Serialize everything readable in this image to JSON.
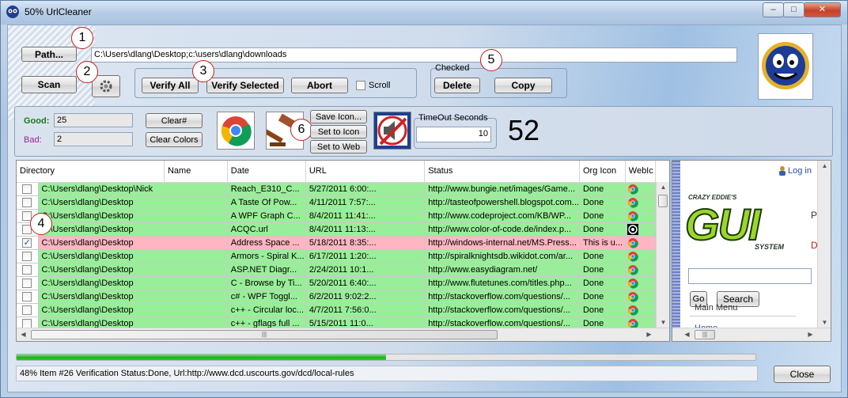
{
  "window": {
    "title": "50% UrlCleaner",
    "min": "–",
    "max": "□",
    "close": "✕"
  },
  "toolbar": {
    "path_label": "Path...",
    "path_value": "C:\\Users\\dlang\\Desktop;c:\\users\\dlang\\downloads",
    "scan_label": "Scan",
    "verify_all_label": "Verify All",
    "verify_selected_label": "Verify Selected",
    "abort_label": "Abort",
    "scroll_label": "Scroll",
    "checked_group_label": "Checked",
    "delete_label": "Delete",
    "copy_label": "Copy"
  },
  "callouts": [
    "1",
    "2",
    "3",
    "4",
    "5",
    "6"
  ],
  "stats": {
    "good_label": "Good:",
    "good_value": "25",
    "bad_label": "Bad:",
    "bad_value": "2",
    "clear_num_label": "Clear#",
    "clear_colors_label": "Clear Colors",
    "save_icon_label": "Save Icon...",
    "set_to_icon_label": "Set to Icon",
    "set_to_web_label": "Set to Web",
    "timeout_label": "TimeOut Seconds",
    "timeout_value": "10",
    "big_count": "52"
  },
  "grid": {
    "columns": [
      "Directory",
      "Name",
      "Date",
      "URL",
      "Status",
      "Org Icon",
      "WebIc"
    ],
    "rows": [
      {
        "checked": false,
        "status_class": "good",
        "directory": "C:\\Users\\dlang\\Desktop\\Nick",
        "name": "Reach_E310_C...",
        "date": "5/27/2011 6:00:...",
        "url": "http://www.bungie.net/images/Game...",
        "status": "Done",
        "org_icon": "chrome",
        "web_icon": ""
      },
      {
        "checked": false,
        "status_class": "good",
        "directory": "C:\\Users\\dlang\\Desktop",
        "name": "A Taste Of Pow...",
        "date": "4/11/2011 7:57:...",
        "url": "http://tasteofpowershell.blogspot.com...",
        "status": "Done",
        "org_icon": "chrome",
        "web_icon": "blogger"
      },
      {
        "checked": false,
        "status_class": "good",
        "directory": "C:\\Users\\dlang\\Desktop",
        "name": "A WPF Graph C...",
        "date": "8/4/2011 11:41:...",
        "url": "http://www.codeproject.com/KB/WP...",
        "status": "Done",
        "org_icon": "chrome",
        "web_icon": "blogger"
      },
      {
        "checked": false,
        "status_class": "good",
        "directory": "C:\\Users\\dlang\\Desktop",
        "name": "ACQC.url",
        "date": "8/4/2011 11:13:...",
        "url": "http://www.color-of-code.de/index.p...",
        "status": "Done",
        "org_icon": "target",
        "web_icon": "target"
      },
      {
        "checked": true,
        "status_class": "bad",
        "directory": "C:\\Users\\dlang\\Desktop",
        "name": "Address Space ...",
        "date": "5/18/2011 8:35:...",
        "url": "http://windows-internal.net/MS.Press...",
        "status": "This is u...",
        "org_icon": "chrome",
        "web_icon": ""
      },
      {
        "checked": false,
        "status_class": "good",
        "directory": "C:\\Users\\dlang\\Desktop",
        "name": "Armors - Spiral K...",
        "date": "6/17/2011 1:20:...",
        "url": "http://spiralknightsdb.wikidot.com/ar...",
        "status": "Done",
        "org_icon": "chrome",
        "web_icon": "wikidot"
      },
      {
        "checked": false,
        "status_class": "good",
        "directory": "C:\\Users\\dlang\\Desktop",
        "name": "ASP.NET Diagr...",
        "date": "2/24/2011 10:1...",
        "url": "http://www.easydiagram.net/",
        "status": "Done",
        "org_icon": "chrome",
        "web_icon": "globe"
      },
      {
        "checked": false,
        "status_class": "good",
        "directory": "C:\\Users\\dlang\\Desktop",
        "name": "C - Browse by Ti...",
        "date": "5/20/2011 6:40:...",
        "url": "http://www.flutetunes.com/titles.php...",
        "status": "Done",
        "org_icon": "chrome",
        "web_icon": "globe"
      },
      {
        "checked": false,
        "status_class": "good",
        "directory": "C:\\Users\\dlang\\Desktop",
        "name": "c# - WPF Toggl...",
        "date": "6/2/2011 9:02:2...",
        "url": "http://stackoverflow.com/questions/...",
        "status": "Done",
        "org_icon": "chrome",
        "web_icon": "stack"
      },
      {
        "checked": false,
        "status_class": "good",
        "directory": "C:\\Users\\dlang\\Desktop",
        "name": "c++ - Circular loc...",
        "date": "4/7/2011 7:56:0...",
        "url": "http://stackoverflow.com/questions/...",
        "status": "Done",
        "org_icon": "chrome",
        "web_icon": "stack"
      },
      {
        "checked": false,
        "status_class": "good",
        "directory": "C:\\Users\\dlang\\Desktop",
        "name": "c++ - gflags full ...",
        "date": "5/15/2011 11:0...",
        "url": "http://stackoverflow.com/questions/...",
        "status": "Done",
        "org_icon": "chrome",
        "web_icon": "stack"
      }
    ]
  },
  "browser": {
    "login_label": "Log in",
    "logo_top": "CRAZY EDDIE'S",
    "logo_main": "GUI",
    "logo_sub": "SYSTEM",
    "side_letter_1": "P",
    "side_letter_2": "D",
    "go_label": "Go",
    "search_label": "Search",
    "main_menu_label": "Main Menu",
    "home_label": "Home"
  },
  "progress": {
    "fraction": 0.5
  },
  "status": {
    "text": "48%  Item #26 Verification Status:Done, Url:http://www.dcd.uscourts.gov/dcd/local-rules"
  },
  "close_label": "Close",
  "colors": {
    "good_row": "#99ee99",
    "bad_row": "#ffb6c1",
    "good_label": "#1a7a1a",
    "bad_label": "#a020a0",
    "progress": "#22b422"
  }
}
